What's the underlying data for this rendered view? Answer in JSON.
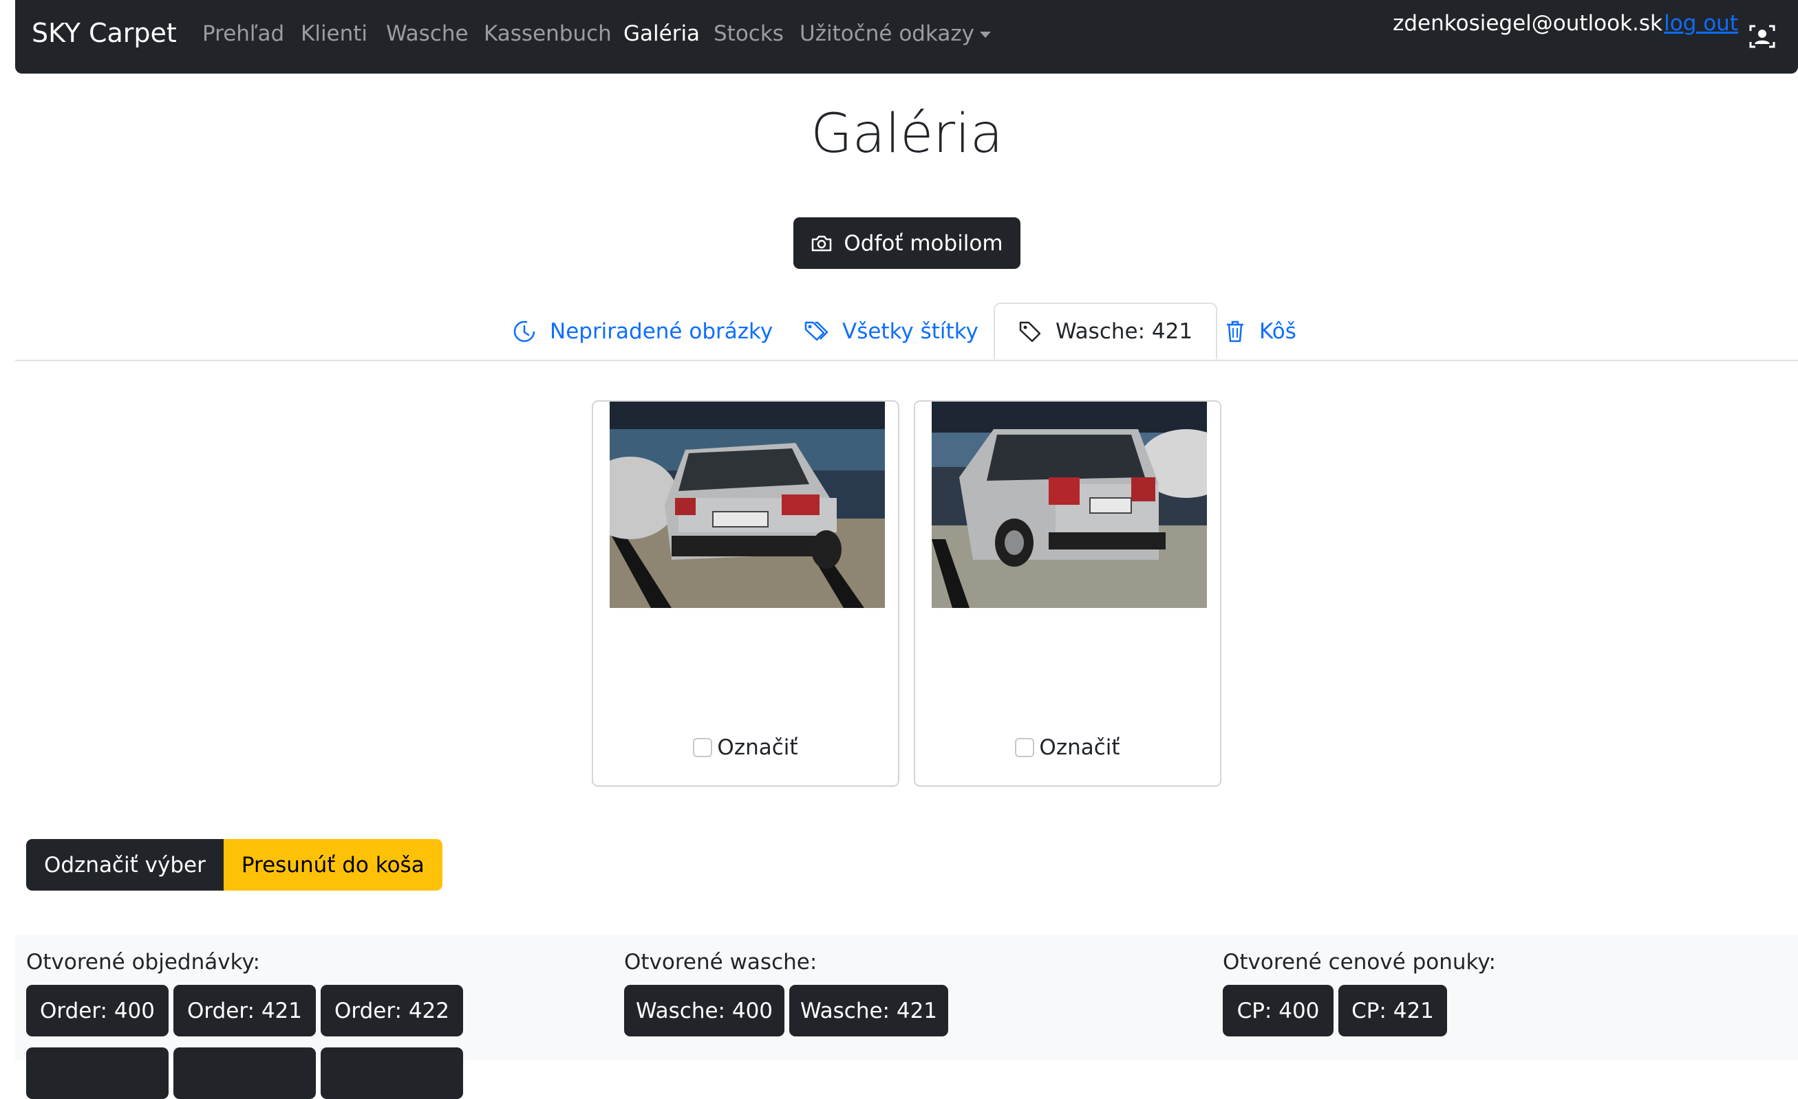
{
  "navbar": {
    "brand": "SKY Carpet",
    "links": [
      "Prehľad",
      "Klienti",
      "Wasche",
      "Kassenbuch",
      "Galéria",
      "Stocks",
      "Užitočné odkazy"
    ],
    "active": "Galéria",
    "user_email": "zdenkosiegel@outlook.sk",
    "logout": "log out",
    "user_icon": "user-badge-icon"
  },
  "page": {
    "title": "Galéria",
    "camera_button": "Odfoť mobilom",
    "camera_icon": "camera-icon"
  },
  "tabs": [
    {
      "label": "Nepriradené obrázky",
      "icon": "clock-icon",
      "active": false
    },
    {
      "label": "Všetky štítky",
      "icon": "tags-icon",
      "active": false
    },
    {
      "label": "Wasche: 421",
      "icon": "tag-icon",
      "active": true
    },
    {
      "label": "Kôš",
      "icon": "trash-icon",
      "active": false
    }
  ],
  "gallery": {
    "items": [
      {
        "checkbox_label": "Označiť",
        "checked": false
      },
      {
        "checkbox_label": "Označiť",
        "checked": false
      }
    ]
  },
  "actions": {
    "deselect": "Odznačiť výber",
    "move_to_trash": "Presunúť do koša"
  },
  "open_lists": {
    "orders": {
      "label": "Otvorené objednávky:",
      "items": [
        "Order: 400",
        "Order: 421",
        "Order: 422"
      ]
    },
    "wasche": {
      "label": "Otvorené wasche:",
      "items": [
        "Wasche: 400",
        "Wasche: 421"
      ]
    },
    "quotes": {
      "label": "Otvorené cenové ponuky:",
      "items": [
        "CP: 400",
        "CP: 421"
      ]
    }
  },
  "colors": {
    "navbar": "#212529",
    "link": "#0d6efd",
    "warning": "#ffc107",
    "panel": "#f8f9fa"
  }
}
